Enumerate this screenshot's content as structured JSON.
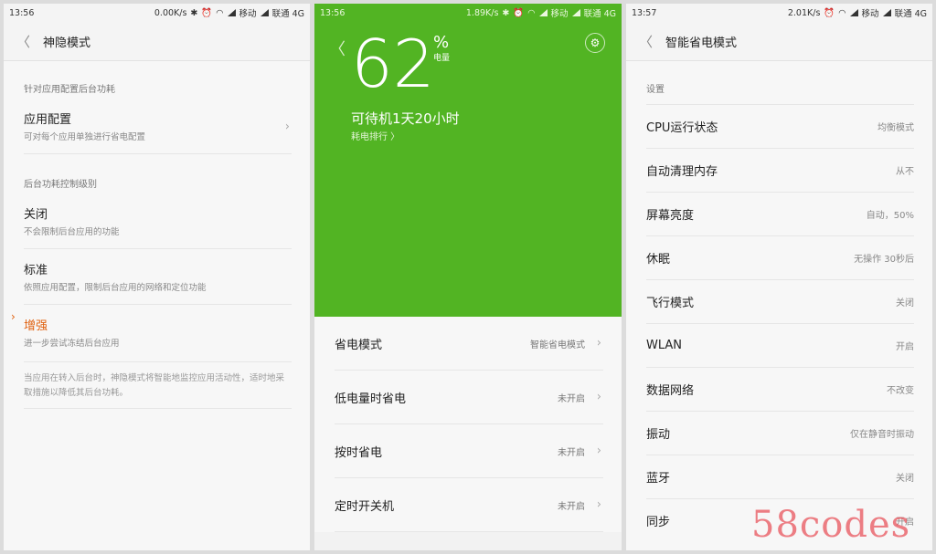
{
  "p1": {
    "status": {
      "time": "13:56",
      "net": "0.00K/s",
      "carrier1": "移动",
      "carrier2": "联通 4G"
    },
    "title": "神隐模式",
    "section1": "针对应用配置后台功耗",
    "app_config": {
      "title": "应用配置",
      "sub": "可对每个应用单独进行省电配置"
    },
    "section2": "后台功耗控制级别",
    "levels": [
      {
        "title": "关闭",
        "sub": "不会限制后台应用的功能"
      },
      {
        "title": "标准",
        "sub": "依照应用配置，限制后台应用的网络和定位功能"
      },
      {
        "title": "增强",
        "sub": "进一步尝试冻结后台应用"
      }
    ],
    "note": "当应用在转入后台时，神隐模式将智能地监控应用活动性，适时地采取措施以降低其后台功耗。"
  },
  "p2": {
    "status": {
      "time": "13:56",
      "net": "1.89K/s",
      "carrier1": "移动",
      "carrier2": "联通 4G"
    },
    "battery": "62",
    "pct_symbol": "%",
    "pct_label": "电量",
    "battery_level": 0.62,
    "standby": "可待机1天20小时",
    "rank": "耗电排行 〉",
    "items": [
      {
        "label": "省电模式",
        "value": "智能省电模式"
      },
      {
        "label": "低电量时省电",
        "value": "未开启"
      },
      {
        "label": "按时省电",
        "value": "未开启"
      },
      {
        "label": "定时开关机",
        "value": "未开启"
      }
    ]
  },
  "p3": {
    "status": {
      "time": "13:57",
      "net": "2.01K/s",
      "carrier1": "移动",
      "carrier2": "联通 4G"
    },
    "title": "智能省电模式",
    "section": "设置",
    "items": [
      {
        "label": "CPU运行状态",
        "value": "均衡模式"
      },
      {
        "label": "自动清理内存",
        "value": "从不"
      },
      {
        "label": "屏幕亮度",
        "value": "自动，50%"
      },
      {
        "label": "休眠",
        "value": "无操作 30秒后"
      },
      {
        "label": "飞行模式",
        "value": "关闭"
      },
      {
        "label": "WLAN",
        "value": "开启"
      },
      {
        "label": "数据网络",
        "value": "不改变"
      },
      {
        "label": "振动",
        "value": "仅在静音时振动"
      },
      {
        "label": "蓝牙",
        "value": "关闭"
      },
      {
        "label": "同步",
        "value": "开启"
      }
    ]
  },
  "watermark": "58codes",
  "colors": {
    "green": "#52b423",
    "accent": "#e0600e"
  }
}
